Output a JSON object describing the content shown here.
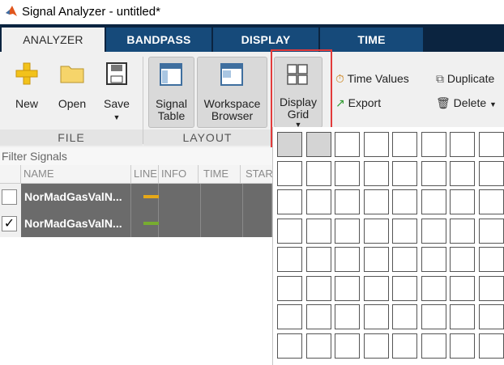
{
  "window": {
    "title": "Signal Analyzer - untitled*"
  },
  "tabs": [
    {
      "label": "ANALYZER",
      "active": true
    },
    {
      "label": "BANDPASS",
      "active": false
    },
    {
      "label": "DISPLAY",
      "active": false
    },
    {
      "label": "TIME",
      "active": false
    }
  ],
  "ribbon": {
    "file": {
      "group_label": "FILE",
      "new_label": "New",
      "open_label": "Open",
      "save_label": "Save"
    },
    "layout": {
      "group_label": "LAYOUT",
      "signal_table_line1": "Signal",
      "signal_table_line2": "Table",
      "workspace_browser_line1": "Workspace",
      "workspace_browser_line2": "Browser",
      "display_grid_line1": "Display",
      "display_grid_line2": "Grid"
    },
    "actions": {
      "time_values_label": "Time Values",
      "export_label": "Export",
      "duplicate_label": "Duplicate",
      "delete_label": "Delete"
    }
  },
  "signals": {
    "filter_placeholder": "Filter Signals",
    "columns": [
      "NAME",
      "LINE",
      "INFO",
      "TIME",
      "STAR"
    ],
    "rows": [
      {
        "name": "NorMadGasValN...",
        "checked": false,
        "line_color": "#e6a817"
      },
      {
        "name": "NorMadGasValN...",
        "checked": true,
        "line_color": "#77ac30"
      }
    ]
  },
  "grid_popup": {
    "rows": 8,
    "cols": 8,
    "selected_rows": 1,
    "selected_cols": 2
  },
  "colors": {
    "tab_dark": "#0b2440",
    "tab": "#164a7a",
    "highlight": "#e23b3b"
  }
}
